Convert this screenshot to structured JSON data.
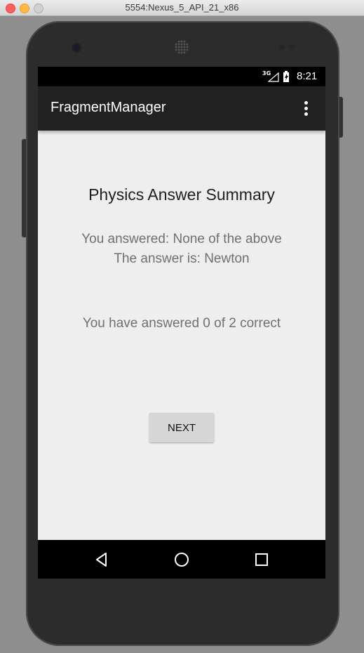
{
  "window": {
    "title": "5554:Nexus_5_API_21_x86"
  },
  "status_bar": {
    "network": "3G",
    "time": "8:21"
  },
  "app_bar": {
    "title": "FragmentManager",
    "menu_icon": "overflow-menu-icon"
  },
  "content": {
    "heading": "Physics Answer Summary",
    "your_answer": "You answered: None of the above",
    "correct_answer": "The answer is: Newton",
    "score": "You have answered 0 of 2 correct",
    "next_label": "NEXT"
  },
  "nav_bar": {
    "icons": [
      "back-icon",
      "home-icon",
      "recents-icon"
    ]
  },
  "colors": {
    "app_bar": "#212121",
    "background": "#eeeeee",
    "button": "#d6d6d6",
    "secondary_text": "#707070"
  }
}
